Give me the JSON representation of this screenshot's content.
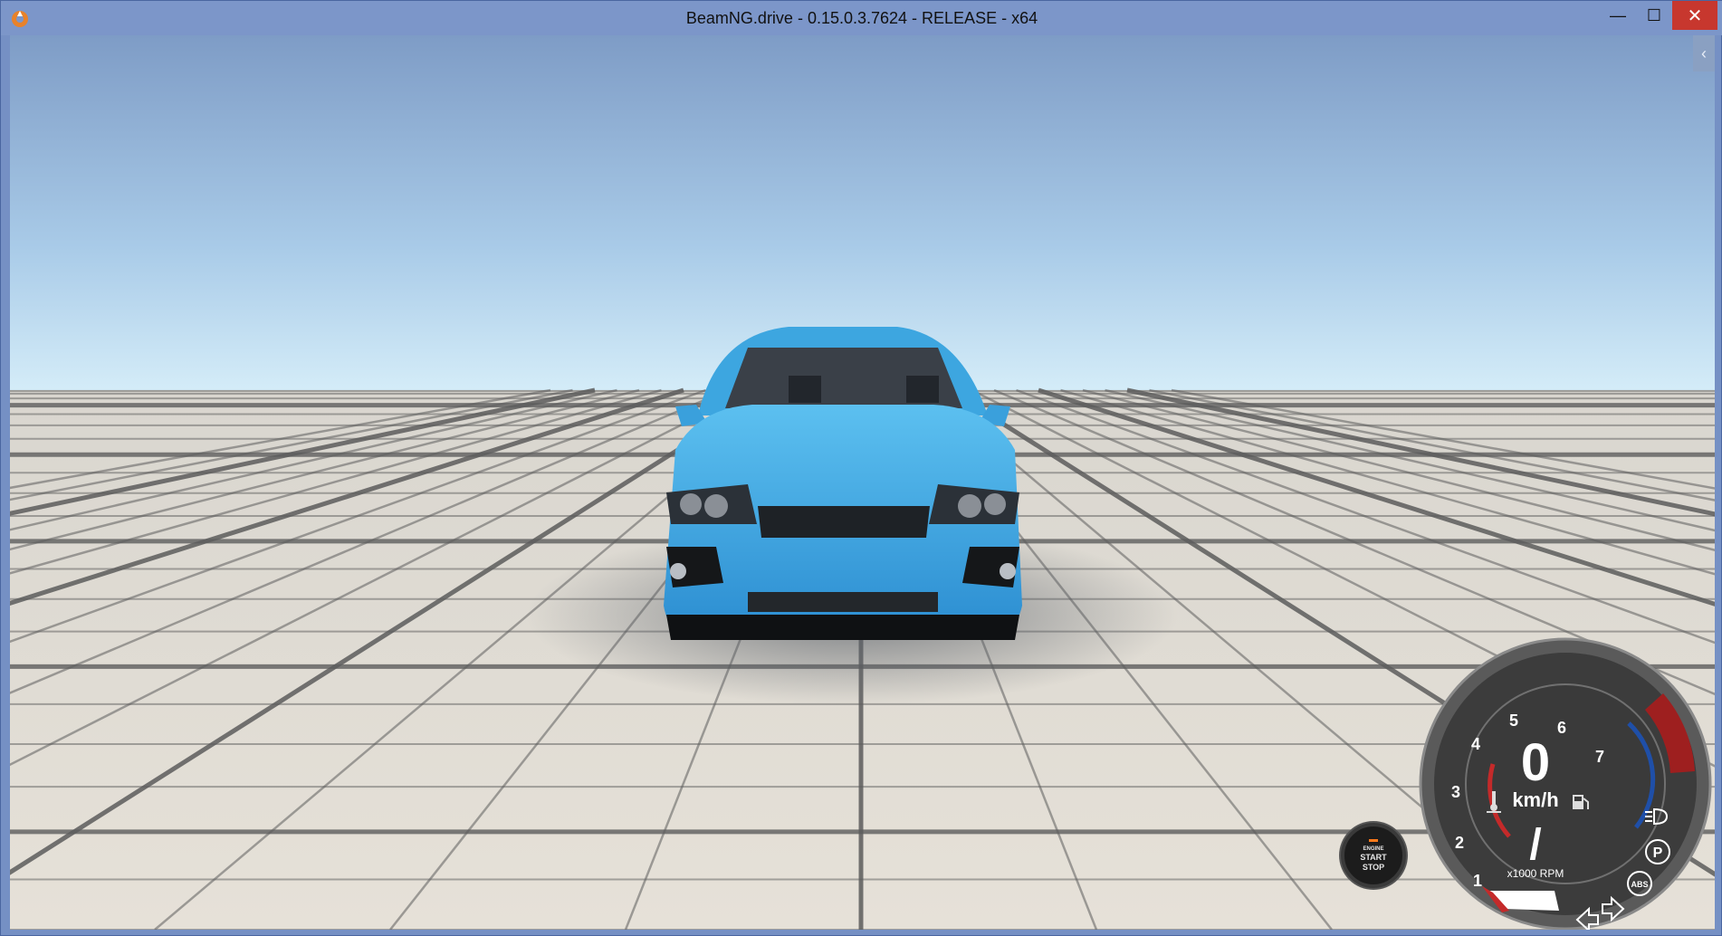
{
  "window": {
    "title": "BeamNG.drive - 0.15.0.3.7624 - RELEASE - x64",
    "controls": {
      "minimize": "—",
      "maximize": "☐",
      "close": "✕"
    },
    "app_icon": "beamng-logo-icon"
  },
  "sidebar_toggle": {
    "icon": "chevron-left-icon",
    "glyph": "‹"
  },
  "engine_button": {
    "line1": "ENGINE",
    "line2": "START",
    "line3": "STOP",
    "indicator_color": "#ff7a1a"
  },
  "dashboard": {
    "speed": "0",
    "speed_unit": "km/h",
    "gear": "/",
    "rpm_label": "x1000 RPM",
    "rpm_ticks": [
      "1",
      "2",
      "3",
      "4",
      "5",
      "6",
      "7"
    ],
    "icons": [
      "temperature-icon",
      "fuel-icon",
      "headlight-icon",
      "parking-brake-icon",
      "abs-icon",
      "left-signal-icon",
      "right-signal-icon"
    ],
    "parking_label": "P",
    "abs_label": "ABS",
    "redline_color": "#9e1f1f",
    "temp_arc_color": "#c42a2a",
    "fuel_arc_color": "#1f4fa8"
  },
  "scene": {
    "sky_top": "#7e9cc6",
    "sky_horizon": "#cfe6f5",
    "ground": "#dcd6cc",
    "grid_line": "#4a4a4a",
    "car_color": "#3aa0dc"
  }
}
